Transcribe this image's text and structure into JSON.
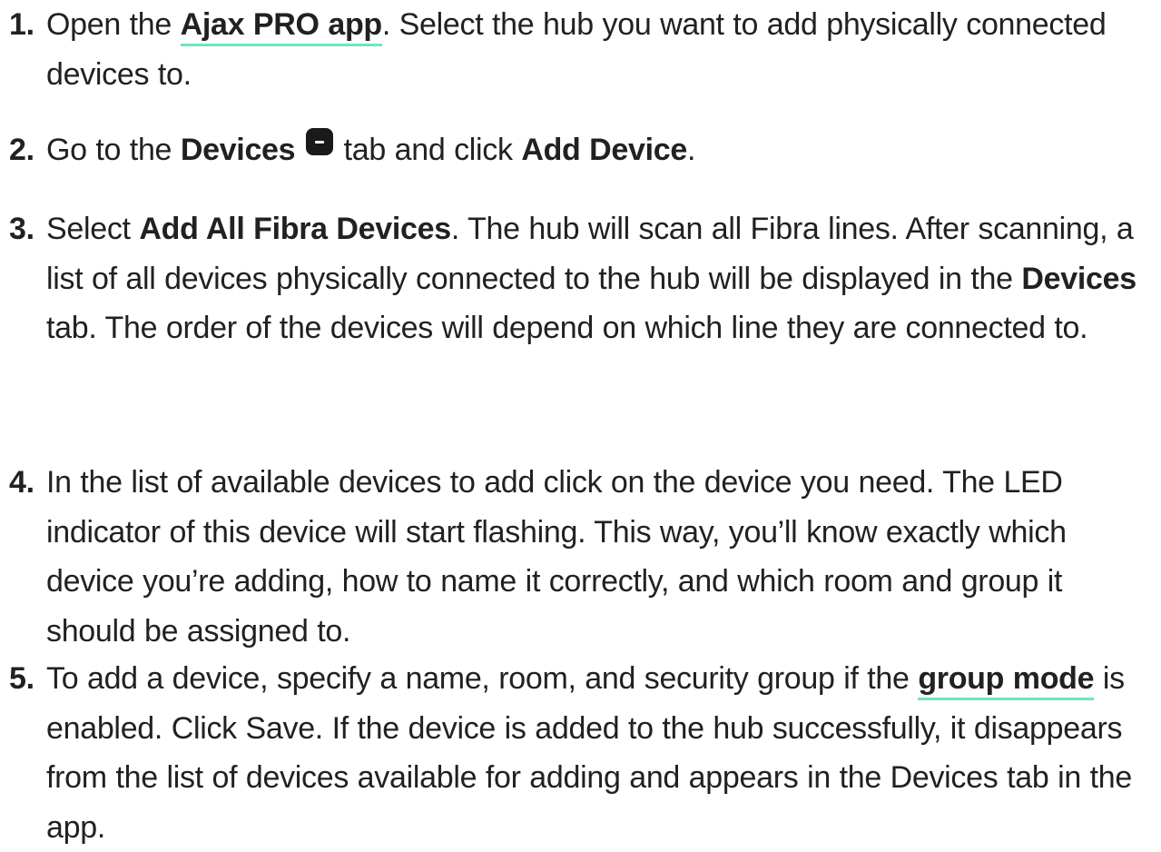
{
  "steps": [
    {
      "number": "1.",
      "t1": "Open the ",
      "link": "Ajax PRO app",
      "t2": ". Select the hub you want to add physically connected devices to."
    },
    {
      "number": "2.",
      "t1": "Go to the ",
      "b1": "Devices",
      "icon": "devices-tab-icon",
      "t2": " tab and click ",
      "b2": "Add Device",
      "t3": "."
    },
    {
      "number": "3.",
      "t1": "Select ",
      "b1": "Add All Fibra Devices",
      "t2": ". The hub will scan all Fibra lines. After scanning, a list of all devices physically connected to the hub will be displayed in the ",
      "b2": "Devices",
      "t3": " tab. The order of the devices will depend on which line they are connected to."
    },
    {
      "number": "4.",
      "t1": "In the list of available devices to add click on the device you need. The LED indicator of this device will start flashing. This way, you’ll know exactly which device you’re adding, how to name it correctly, and which room and group it should be assigned to."
    },
    {
      "number": "5.",
      "t1": "To add a device, specify a name, room, and security group if the ",
      "link": "group mode",
      "t2": " is enabled. Click Save. If the device is added to the hub successfully, it disappears from the list of devices available for adding and appears in the Devices tab in the app."
    }
  ],
  "colors": {
    "text": "#212121",
    "link_underline": "#6ee7b7",
    "icon_bg": "#1a1a1a"
  }
}
